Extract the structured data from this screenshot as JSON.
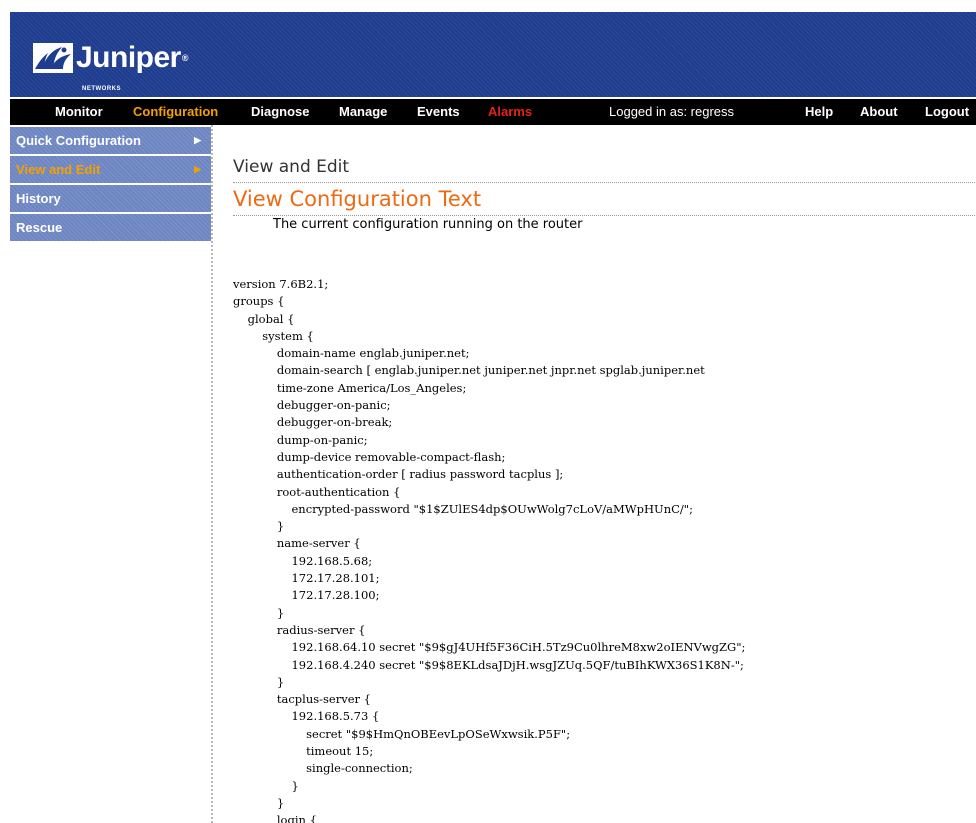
{
  "brand": {
    "name": "Juniper",
    "sub": "NETWORKS",
    "registered": "®"
  },
  "nav": {
    "items": [
      "Monitor",
      "Configuration",
      "Diagnose",
      "Manage",
      "Events",
      "Alarms"
    ],
    "logged_in": "Logged in as: regress",
    "right_items": [
      "Help",
      "About",
      "Logout"
    ]
  },
  "sidebar": {
    "items": [
      {
        "label": "Quick Configuration",
        "arrow": "▶"
      },
      {
        "label": "View and Edit",
        "arrow": "▶"
      },
      {
        "label": "History",
        "arrow": ""
      },
      {
        "label": "Rescue",
        "arrow": ""
      }
    ]
  },
  "main": {
    "breadcrumb": "View and Edit",
    "title": "View Configuration Text",
    "subtitle": "The current configuration running on the router",
    "config_lines": [
      "version 7.6B2.1;",
      "groups {",
      "    global {",
      "        system {",
      "            domain-name englab.juniper.net;",
      "            domain-search [ englab.juniper.net juniper.net jnpr.net spglab.juniper.net",
      "            time-zone America/Los_Angeles;",
      "            debugger-on-panic;",
      "            debugger-on-break;",
      "            dump-on-panic;",
      "            dump-device removable-compact-flash;",
      "            authentication-order [ radius password tacplus ];",
      "            root-authentication {",
      "                encrypted-password \"$1$ZUlES4dp$OUwWolg7cLoV/aMWpHUnC/\";",
      "            }",
      "            name-server {",
      "                192.168.5.68;",
      "                172.17.28.101;",
      "                172.17.28.100;",
      "            }",
      "            radius-server {",
      "                192.168.64.10 secret \"$9$gJ4UHf5F36CiH.5Tz9Cu0lhreM8xw2oIENVwgZG\";",
      "                192.168.4.240 secret \"$9$8EKLdsaJDjH.wsgJZUq.5QF/tuBIhKWX36S1K8N-\";",
      "            }",
      "            tacplus-server {",
      "                192.168.5.73 {",
      "                    secret \"$9$HmQnOBEevLpOSeWxwsik.P5F\";",
      "                    timeout 15;",
      "                    single-connection;",
      "                }",
      "            }",
      "            login {"
    ]
  }
}
